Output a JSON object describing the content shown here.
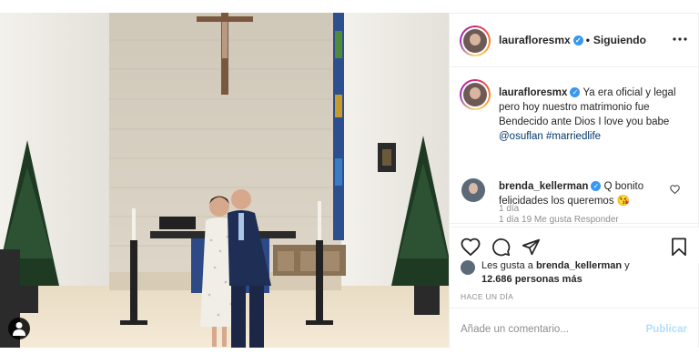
{
  "post": {
    "username": "laurafloresmx",
    "follow_dot": "•",
    "follow_status": "Siguiendo",
    "caption_text": "Ya era oficial y legal pero hoy nuestro matrimonio fue Bendecido ante Dios I love you babe",
    "caption_mention": "@osuflan",
    "caption_hashtag": "#marriedlife",
    "caption_time": "1 día"
  },
  "comment": {
    "username": "brenda_kellerman",
    "text": "Q bonito felicidades los queremos",
    "emoji": "😘",
    "meta": "1 día   19 Me gusta   Responder"
  },
  "likes": {
    "prefix": "Les gusta a",
    "user": "brenda_kellerman",
    "conj": "y",
    "count_text": "12.686 personas más"
  },
  "date_label": "HACE UN DÍA",
  "add_comment": {
    "placeholder": "Añade un comentario...",
    "publish": "Publicar"
  },
  "icons": {
    "verified": "verified-badge-icon",
    "more": "more-options-icon",
    "like": "heart-icon",
    "comment": "comment-icon",
    "share": "share-icon",
    "save": "bookmark-icon",
    "user_tag": "user-tag-icon"
  },
  "colors": {
    "verified": "#3897f0",
    "link": "#00376b",
    "publish_disabled": "#b2dffc",
    "meta_gray": "#8e8e8e"
  }
}
